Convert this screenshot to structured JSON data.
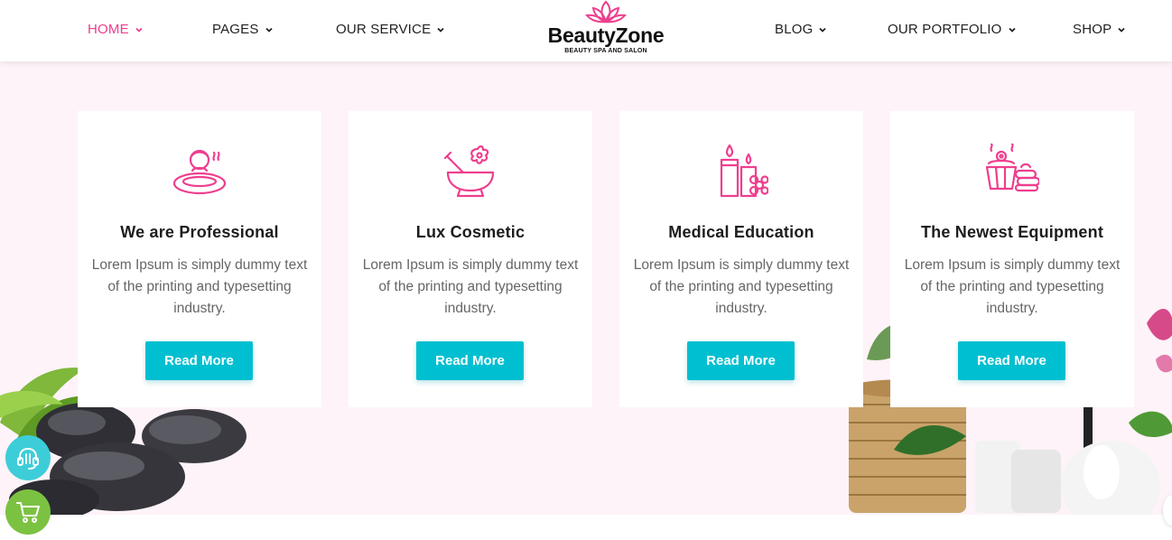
{
  "nav": {
    "left": [
      {
        "label": "HOME",
        "active": true
      },
      {
        "label": "PAGES",
        "active": false
      },
      {
        "label": "OUR SERVICE",
        "active": false
      }
    ],
    "right": [
      {
        "label": "BLOG",
        "active": false
      },
      {
        "label": "OUR PORTFOLIO",
        "active": false
      },
      {
        "label": "SHOP",
        "active": false
      }
    ]
  },
  "logo": {
    "name": "BeautyZone",
    "tagline": "BEAUTY SPA AND SALON",
    "icon": "lotus-icon"
  },
  "features": [
    {
      "icon": "spa-bath-icon",
      "title": "We are Professional",
      "text": "Lorem Ipsum is simply dummy text of the printing and typesetting industry.",
      "button": "Read More"
    },
    {
      "icon": "mortar-flower-icon",
      "title": "Lux Cosmetic",
      "text": "Lorem Ipsum is simply dummy text of the printing and typesetting industry.",
      "button": "Read More"
    },
    {
      "icon": "candles-icon",
      "title": "Medical Education",
      "text": "Lorem Ipsum is simply dummy text of the printing and typesetting industry.",
      "button": "Read More"
    },
    {
      "icon": "spa-equipment-icon",
      "title": "The Newest Equipment",
      "text": "Lorem Ipsum is simply dummy text of the printing and typesetting industry.",
      "button": "Read More"
    }
  ],
  "colors": {
    "accent_pink": "#ee3f8e",
    "button_teal": "#00bfd0",
    "section_bg": "#fdf3f8",
    "support_fab": "#3dcdd8",
    "cart_fab": "#7cc242"
  },
  "floating": {
    "support_icon": "headset-icon",
    "cart_icon": "cart-icon"
  }
}
